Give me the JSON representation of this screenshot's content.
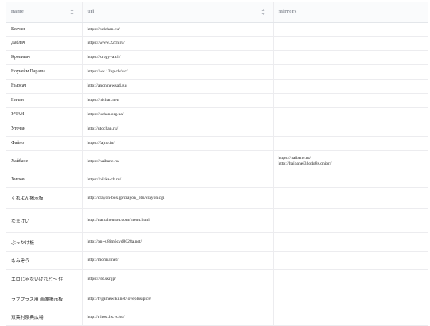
{
  "table": {
    "columns": [
      {
        "label": "name",
        "sortable": true
      },
      {
        "label": "url",
        "sortable": true
      },
      {
        "label": "mirrors",
        "sortable": false
      }
    ],
    "rows": [
      {
        "name": "Белчан",
        "url": "https://belchan.eu/",
        "mirrors": []
      },
      {
        "name": "Даблач",
        "url": "https://www.22ch.ru/",
        "mirrors": []
      },
      {
        "name": "Кропивач",
        "url": "https://kropyva.ch/",
        "mirrors": []
      },
      {
        "name": "Ноунейм Параша",
        "url": "https://wc.12hp.ch/wc/",
        "mirrors": []
      },
      {
        "name": "Ньюсач",
        "url": "http://anon.newsa4.ru/",
        "mirrors": []
      },
      {
        "name": "Ничан",
        "url": "https://nichan.net/",
        "mirrors": []
      },
      {
        "name": "УЧАН",
        "url": "https://uchan.org.ua/",
        "mirrors": []
      },
      {
        "name": "Уточан",
        "url": "http://utochan.ru/",
        "mirrors": []
      },
      {
        "name": "Файно",
        "url": "https://fajno.in/",
        "mirrors": []
      },
      {
        "name": "Хайбане",
        "url": "https://haibane.ru/",
        "mirrors": [
          "https://haibane.ru/",
          "http://haibanej33o4g8s.onion/"
        ]
      },
      {
        "name": "Хиккач",
        "url": "https://hikka-ch.ru/",
        "mirrors": []
      },
      {
        "name": "くれよん掲示板",
        "url": "http://crayon-box.jp/crayon_bbs/crayon.cgi",
        "mirrors": []
      },
      {
        "name": "なまけい",
        "url": "http://namahousou.com/menu.html",
        "mirrors": []
      },
      {
        "name": "ぶっかけ板",
        "url": "http://xn--u8jm6cyd8028a.net/",
        "mirrors": []
      },
      {
        "name": "もみぞう",
        "url": "http://momi3.net/",
        "mirrors": []
      },
      {
        "name": "エロじゃないけれど〜 住",
        "url": "https://3d.skr.jp/",
        "mirrors": []
      },
      {
        "name": "ラブプラス用 画像掲示板",
        "url": "http://tvgamewiki.net/loveplus/pics/",
        "mirrors": []
      },
      {
        "name": "双葉村祭典広場",
        "url": "http://rthost.hs.vc/sd/",
        "mirrors": []
      }
    ]
  }
}
